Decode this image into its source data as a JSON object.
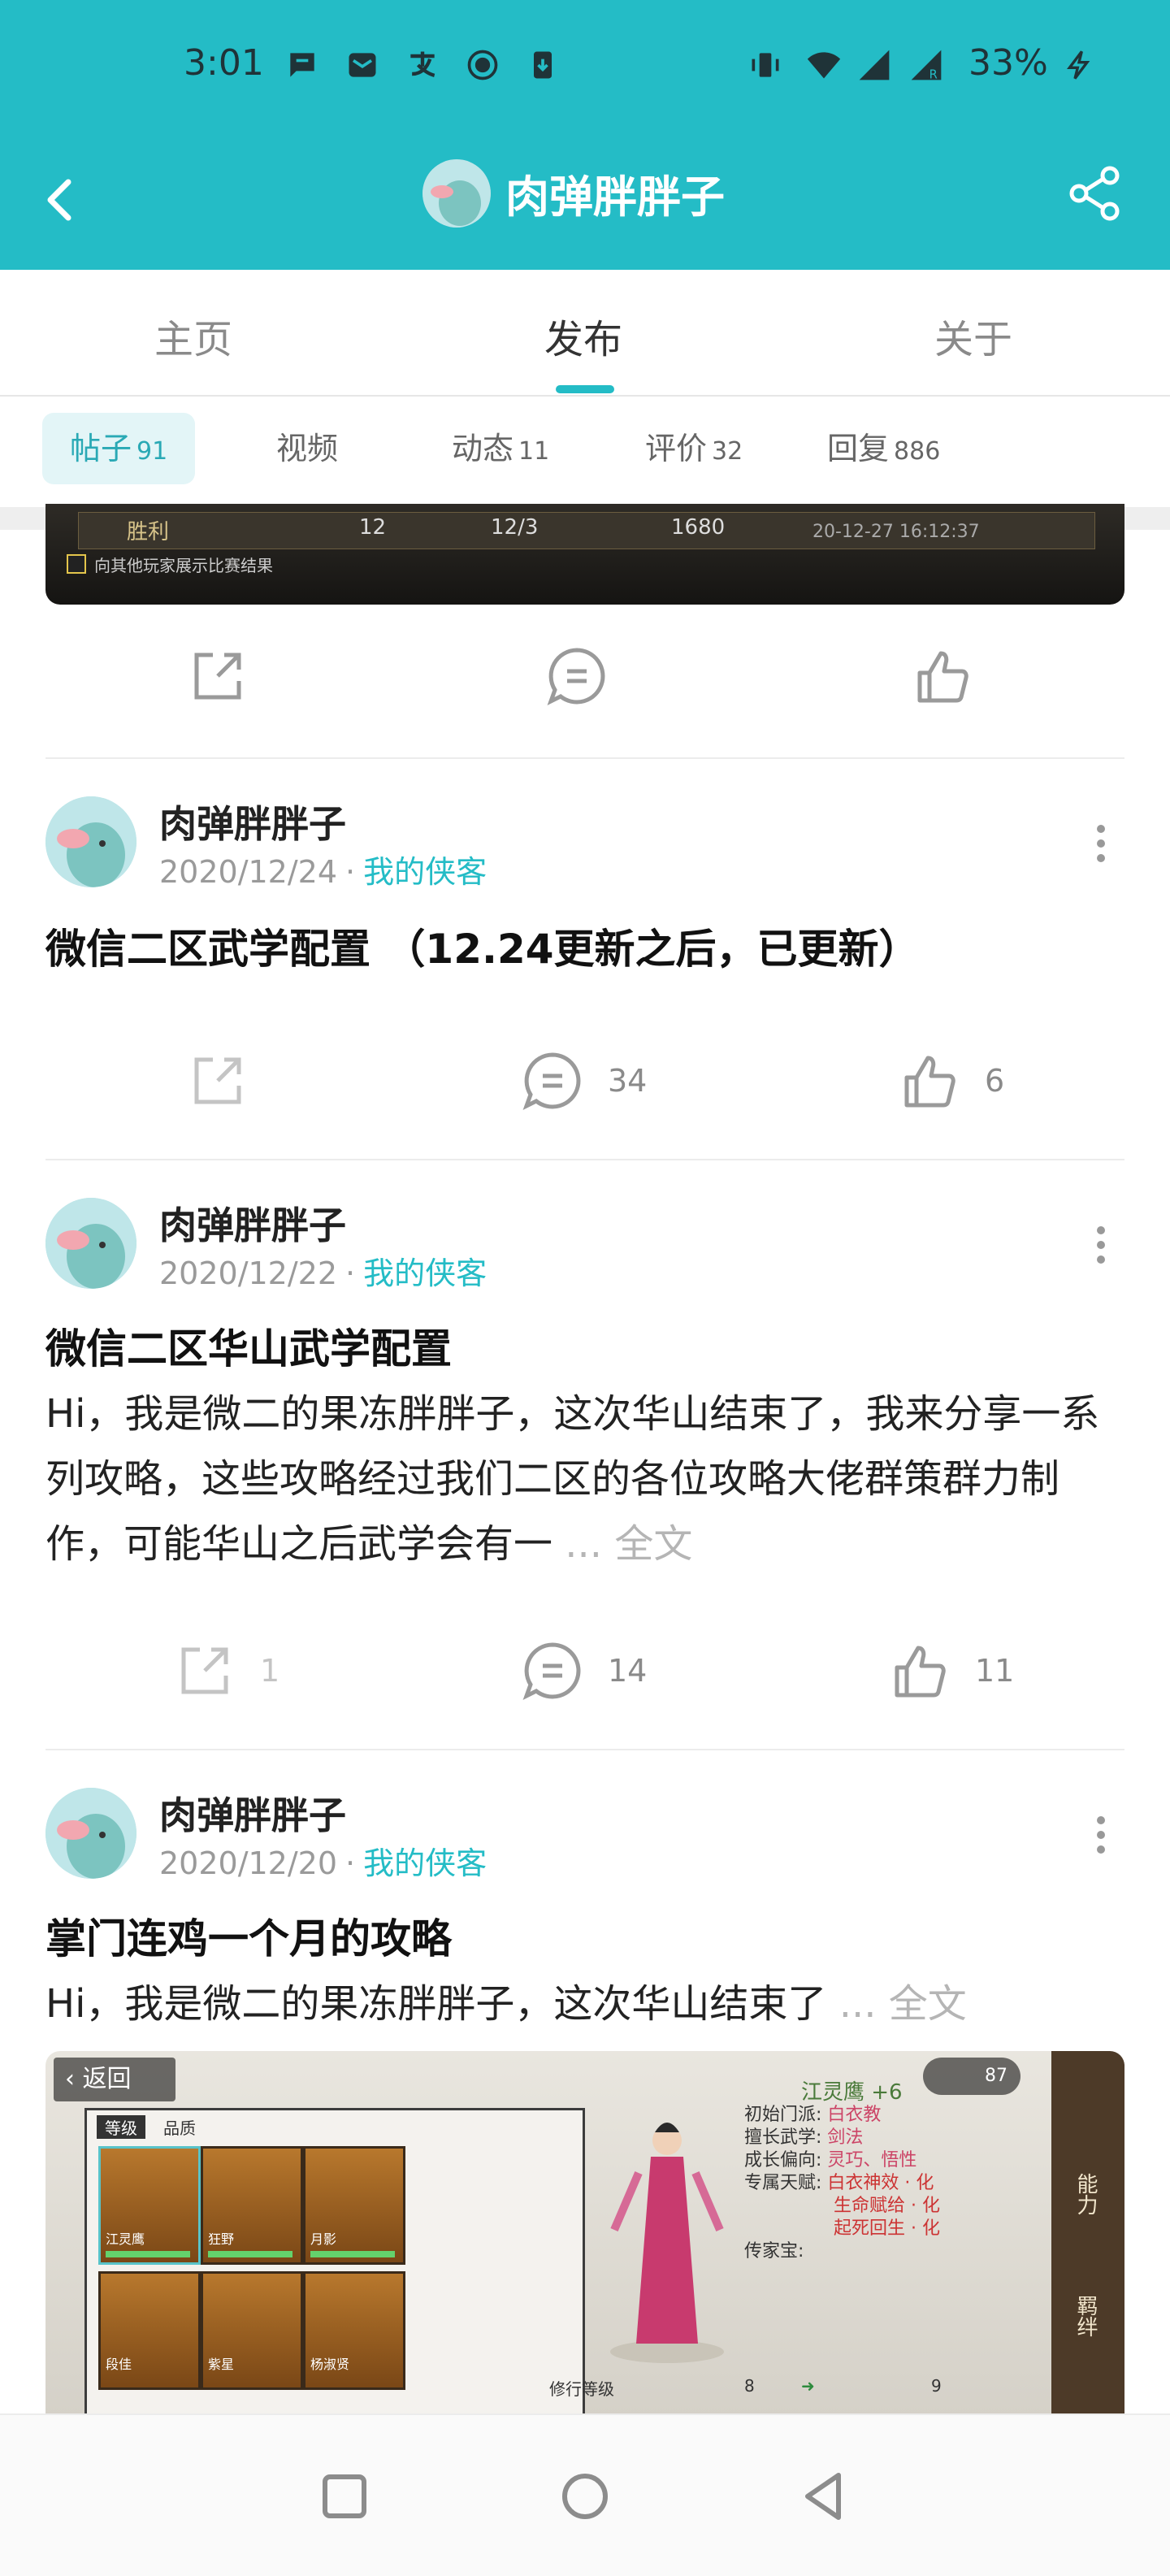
{
  "status_bar": {
    "time": "3:01",
    "battery": "33%"
  },
  "header": {
    "title": "肉弹胖胖子"
  },
  "tabs": [
    {
      "label": "主页"
    },
    {
      "label": "发布"
    },
    {
      "label": "关于"
    }
  ],
  "subtabs": [
    {
      "label": "帖子",
      "count": "91"
    },
    {
      "label": "视频",
      "count": ""
    },
    {
      "label": "动态",
      "count": "11"
    },
    {
      "label": "评价",
      "count": "32"
    },
    {
      "label": "回复",
      "count": "886"
    }
  ],
  "top_image": {
    "row_text": [
      "胜利",
      "12",
      "12/3",
      "1680",
      "20-12-27 16:12:37"
    ],
    "checkbox_label": "向其他玩家展示比赛结果"
  },
  "posts": [
    {
      "author": "肉弹胖胖子",
      "date": "2020/12/24",
      "tag": "我的侠客",
      "title": "微信二区武学配置 （12.24更新之后，已更新）",
      "share": "",
      "comments": "34",
      "likes": "6"
    },
    {
      "author": "肉弹胖胖子",
      "date": "2020/12/22",
      "tag": "我的侠客",
      "title": "微信二区华山武学配置",
      "body": "Hi，我是微二的果冻胖胖子，这次华山结束了，我来分享一系列攻略，这些攻略经过我们二区的各位攻略大佬群策群力制作，可能华山之后武学会有一",
      "full_text": "... 全文",
      "share": "1",
      "comments": "14",
      "likes": "11"
    },
    {
      "author": "肉弹胖胖子",
      "date": "2020/12/20",
      "tag": "我的侠客",
      "title": "掌门连鸡一个月的攻略",
      "body": "Hi，我是微二的果冻胖胖子，这次华山结束了",
      "full_text": "... 全文"
    }
  ],
  "game_image": {
    "back": "返回",
    "tabs": [
      "等级",
      "品质"
    ],
    "badge": "87",
    "char_name": "江灵鹰 +6",
    "cards": [
      "江灵鹰",
      "狂野",
      "月影",
      "段佳",
      "紫星",
      "杨淑贤"
    ],
    "stats": [
      [
        "初始门派:",
        "白衣教"
      ],
      [
        "擅长武学:",
        "剑法"
      ],
      [
        "成长偏向:",
        "灵巧、悟性"
      ],
      [
        "专属天赋:",
        "白衣神效 · 化"
      ],
      [
        "",
        "生命赋给 · 化"
      ],
      [
        "",
        "起死回生 · 化"
      ],
      [
        "传家宝:",
        ""
      ]
    ],
    "level_row": [
      "修行等级",
      "8",
      "9"
    ],
    "side_labels": [
      "能力",
      "羁绊"
    ]
  }
}
